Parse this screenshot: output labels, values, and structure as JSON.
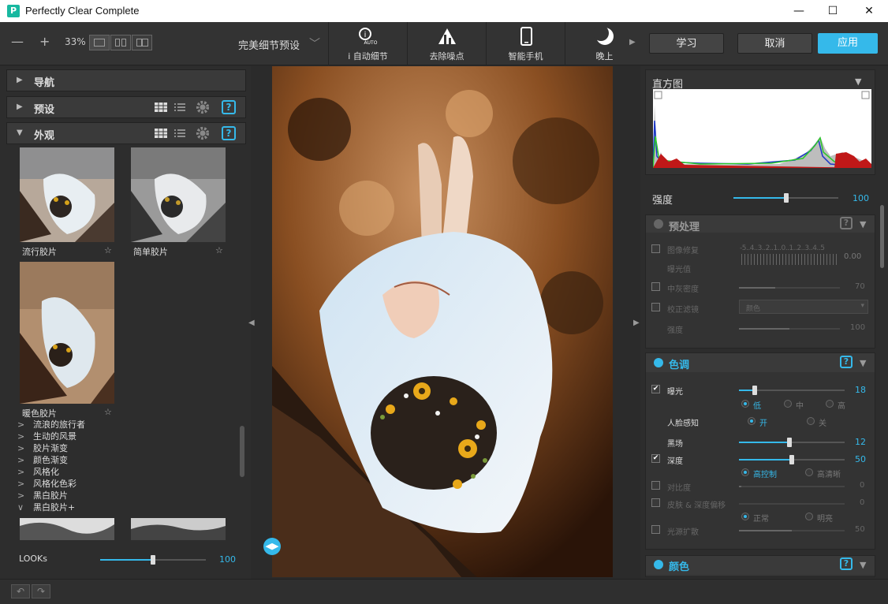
{
  "window": {
    "title": "Perfectly Clear Complete",
    "icon": "pc-app-icon",
    "minimize": "—",
    "maximize": "☐",
    "close": "✕"
  },
  "toolbar": {
    "zoom_out": "—",
    "zoom_in": "+",
    "zoom": "33%",
    "preset": "完美细节预设",
    "tools": [
      {
        "label": "i 自动细节",
        "icon": "auto-detail-icon"
      },
      {
        "label": "去除噪点",
        "icon": "denoise-icon"
      },
      {
        "label": "智能手机",
        "icon": "smartphone-icon"
      },
      {
        "label": "晚上",
        "icon": "moon-icon"
      }
    ],
    "learn": "学习",
    "cancel": "取消",
    "apply": "应用"
  },
  "left": {
    "sections": {
      "nav": "导航",
      "presets": "预设",
      "looks": "外观"
    },
    "thumbs": [
      {
        "label": "流行胶片"
      },
      {
        "label": "简单胶片"
      },
      {
        "label": "暖色胶片"
      }
    ],
    "looks_list": [
      {
        "label": "流浪的旅行者",
        "chev": ">"
      },
      {
        "label": "生动的风景",
        "chev": ">"
      },
      {
        "label": "胶片渐变",
        "chev": ">"
      },
      {
        "label": "颜色渐变",
        "chev": ">"
      },
      {
        "label": "风格化",
        "chev": ">"
      },
      {
        "label": "风格化色彩",
        "chev": ">"
      },
      {
        "label": "黑白胶片",
        "chev": ">"
      },
      {
        "label": "黑白胶片+",
        "chev": "∨"
      }
    ],
    "looks_slider": {
      "label": "LOOKs",
      "value": "100",
      "level": 0.5
    }
  },
  "right": {
    "histogram": {
      "title": "直方图"
    },
    "strength": {
      "label": "强度",
      "value": "100",
      "level": 0.5
    },
    "preprocess": {
      "title": "预处理",
      "rows": [
        {
          "label": "图像修复",
          "value": "0.00"
        },
        {
          "label": "曝光值"
        },
        {
          "label": "中灰密度",
          "value": "70"
        },
        {
          "label": "校正滤镜",
          "select": "颜色"
        },
        {
          "label": "强度",
          "value": "100"
        }
      ],
      "ruler": "-5..4..3..2..1..0..1..2..3..4..5"
    },
    "tone": {
      "title": "色调",
      "exposure": {
        "label": "曝光",
        "value": "18",
        "level": 0.15,
        "options": [
          "低",
          "中",
          "高"
        ]
      },
      "face": {
        "label": "人脸感知",
        "options": [
          "开",
          "关"
        ]
      },
      "black": {
        "label": "黑场",
        "value": "12",
        "level": 0.48
      },
      "depth": {
        "label": "深度",
        "value": "50",
        "level": 0.5,
        "options": [
          "高控制",
          "高清晰"
        ]
      },
      "contrast": {
        "label": "对比度",
        "value": "0"
      },
      "skin": {
        "label": "皮肤 & 深度偏移",
        "value": "0",
        "options": [
          "正常",
          "明亮"
        ]
      },
      "light": {
        "label": "光源扩散",
        "value": "50"
      }
    },
    "color": {
      "title": "颜色"
    }
  },
  "status": {
    "undo": "↶",
    "redo": "↷"
  },
  "colors": {
    "accent": "#35b9ea",
    "panel": "#2d2d2d",
    "toolbar": "#333333"
  }
}
